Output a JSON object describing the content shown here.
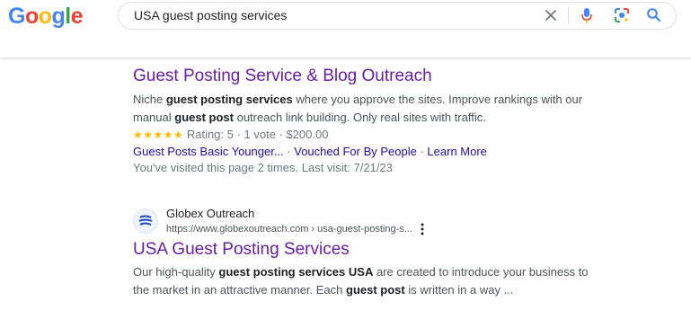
{
  "header": {
    "logo": "Google",
    "logo_colors": [
      "#4285F4",
      "#EA4335",
      "#FBBC05",
      "#4285F4",
      "#34A853",
      "#EA4335"
    ],
    "search": {
      "query": "USA guest posting services"
    },
    "icons": [
      "clear-icon",
      "mic-icon",
      "lens-icon",
      "search-icon"
    ]
  },
  "results": [
    {
      "title": "Guest Posting Service & Blog Outreach",
      "snippet": [
        {
          "t": "Niche ",
          "b": false
        },
        {
          "t": "guest posting services",
          "b": true
        },
        {
          "t": " where you approve the sites. Improve rankings with our manual ",
          "b": false
        },
        {
          "t": "guest post",
          "b": true
        },
        {
          "t": " outreach link building. Only real sites with traffic.",
          "b": false
        }
      ],
      "rating": {
        "stars": "★★★★★",
        "value": 5,
        "text": "Rating: 5 · 1 vote · $200.00"
      },
      "sitelinks": [
        "Guest Posts Basic Younger...",
        "Vouched For By People",
        "Learn More"
      ],
      "visited": "You've visited this page 2 times. Last visit: 7/21/23"
    },
    {
      "site_name": "Globex Outreach",
      "url": "https://www.globexoutreach.com › usa-guest-posting-s...",
      "title": "USA Guest Posting Services",
      "snippet": [
        {
          "t": "Our high-quality ",
          "b": false
        },
        {
          "t": "guest posting services USA",
          "b": true
        },
        {
          "t": " are created to introduce your business to the market in an attractive manner. Each ",
          "b": false
        },
        {
          "t": "guest post",
          "b": true
        },
        {
          "t": " is written in a way ...",
          "b": false
        }
      ]
    }
  ],
  "colors": {
    "link_visited": "#681da8",
    "link": "#1a0dab",
    "star": "#fbbc04"
  }
}
